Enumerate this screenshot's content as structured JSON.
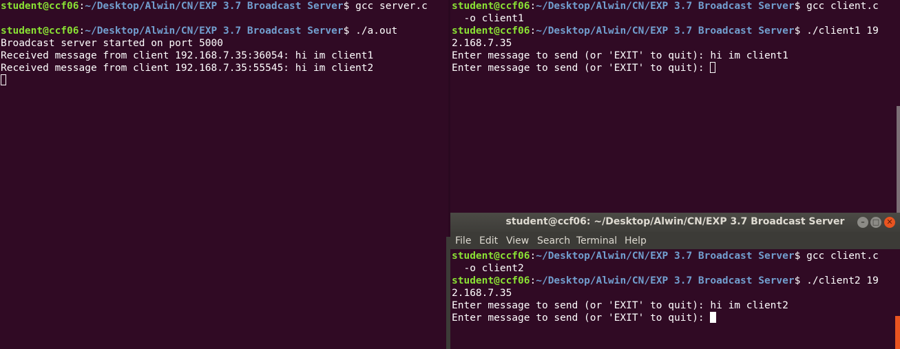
{
  "server_terminal": {
    "lines": {
      "l1": {
        "user_host": "student@ccf06",
        "sep": ":",
        "path": "~/Desktop/Alwin/CN/EXP 3.7 Broadcast Server",
        "cmd": "$ gcc server.c"
      },
      "l2": {
        "user_host": "student@ccf06",
        "sep": ":",
        "path": "~/Desktop/Alwin/CN/EXP 3.7 Broadcast Server",
        "cmd": "$ ./a.out"
      },
      "l3": "Broadcast server started on port 5000",
      "l4": "Received message from client 192.168.7.35:36054: hi im client1",
      "l5": "Received message from client 192.168.7.35:55545: hi im client2"
    }
  },
  "client1_terminal": {
    "lines": {
      "l1": {
        "user_host": "student@ccf06",
        "sep": ":",
        "path": "~/Desktop/Alwin/CN/EXP 3.7 Broadcast Server",
        "cmd": "$ gcc client.c"
      },
      "l1b": "  -o client1",
      "l2": {
        "user_host": "student@ccf06",
        "sep": ":",
        "path": "~/Desktop/Alwin/CN/EXP 3.7 Broadcast Server",
        "cmd": "$ ./client1 19"
      },
      "l2b": "2.168.7.35",
      "l3": "Enter message to send (or 'EXIT' to quit): hi im client1",
      "l4": "Enter message to send (or 'EXIT' to quit): "
    }
  },
  "client2_window": {
    "title": "student@ccf06: ~/Desktop/Alwin/CN/EXP 3.7 Broadcast Server",
    "menu": {
      "file": "File",
      "edit": "Edit",
      "view": "View",
      "search": "Search",
      "terminal": "Terminal",
      "help": "Help"
    },
    "lines": {
      "l1": {
        "user_host": "student@ccf06",
        "sep": ":",
        "path": "~/Desktop/Alwin/CN/EXP 3.7 Broadcast Server",
        "cmd": "$ gcc client.c"
      },
      "l1b": "  -o client2",
      "l2": {
        "user_host": "student@ccf06",
        "sep": ":",
        "path": "~/Desktop/Alwin/CN/EXP 3.7 Broadcast Server",
        "cmd": "$ ./client2 19"
      },
      "l2b": "2.168.7.35",
      "l3": "Enter message to send (or 'EXIT' to quit): hi im client2",
      "l4": "Enter message to send (or 'EXIT' to quit): "
    }
  },
  "colors": {
    "background": "#300a24",
    "prompt_user": "#8ae234",
    "prompt_path": "#729fcf",
    "text": "#ffffff",
    "accent": "#e95420"
  }
}
